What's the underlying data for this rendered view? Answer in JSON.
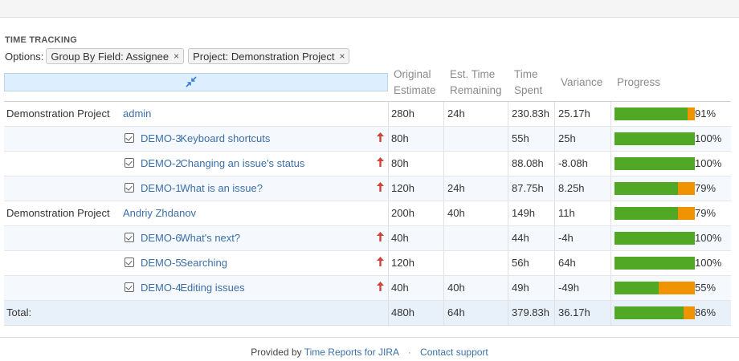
{
  "section_title": "TIME TRACKING",
  "options_label": "Options:",
  "filters": [
    {
      "label": "Group By Field: Assignee",
      "remove": "×"
    },
    {
      "label": "Project: Demonstration Project",
      "remove": "×"
    }
  ],
  "columns": {
    "original_estimate": [
      "Original",
      "Estimate"
    ],
    "est_time_remaining": [
      "Est. Time",
      "Remaining"
    ],
    "time_spent": [
      "Time",
      "Spent"
    ],
    "variance": "Variance",
    "progress": "Progress"
  },
  "colors": {
    "progress_done": "#51a825",
    "progress_remaining": "#f09300",
    "link": "#3b6ea8",
    "priority": "#d04437"
  },
  "rows": [
    {
      "type": "group",
      "project": "Demonstration Project",
      "assignee": "admin",
      "original": "280h",
      "remaining": "24h",
      "spent": "230.83h",
      "variance": "25.17h",
      "progress": 0.91,
      "progress_label": "91%"
    },
    {
      "type": "issue",
      "key": "DEMO-3",
      "summary": "Keyboard shortcuts",
      "issue_icon": "issue-task-icon",
      "priority_icon": "priority-major-arrow-up-icon",
      "original": "80h",
      "remaining": "",
      "spent": "55h",
      "variance": "25h",
      "progress": 1.0,
      "progress_label": "100%"
    },
    {
      "type": "issue",
      "key": "DEMO-2",
      "summary": "Changing an issue's status",
      "issue_icon": "issue-task-icon",
      "priority_icon": "priority-major-arrow-up-icon",
      "original": "80h",
      "remaining": "",
      "spent": "88.08h",
      "variance": "-8.08h",
      "progress": 1.0,
      "progress_label": "100%"
    },
    {
      "type": "issue",
      "key": "DEMO-1",
      "summary": "What is an issue?",
      "issue_icon": "issue-task-icon",
      "priority_icon": "priority-major-arrow-up-icon",
      "original": "120h",
      "remaining": "24h",
      "spent": "87.75h",
      "variance": "8.25h",
      "progress": 0.79,
      "progress_label": "79%"
    },
    {
      "type": "group",
      "project": "Demonstration Project",
      "assignee": "Andriy Zhdanov",
      "original": "200h",
      "remaining": "40h",
      "spent": "149h",
      "variance": "11h",
      "progress": 0.79,
      "progress_label": "79%"
    },
    {
      "type": "issue",
      "key": "DEMO-6",
      "summary": "What's next?",
      "issue_icon": "issue-task-icon",
      "priority_icon": "priority-major-arrow-up-icon",
      "original": "40h",
      "remaining": "",
      "spent": "44h",
      "variance": "-4h",
      "progress": 1.0,
      "progress_label": "100%"
    },
    {
      "type": "issue",
      "key": "DEMO-5",
      "summary": "Searching",
      "issue_icon": "issue-task-icon",
      "priority_icon": "priority-major-arrow-up-icon",
      "original": "120h",
      "remaining": "",
      "spent": "56h",
      "variance": "64h",
      "progress": 1.0,
      "progress_label": "100%"
    },
    {
      "type": "issue",
      "key": "DEMO-4",
      "summary": "Editing issues",
      "issue_icon": "issue-task-icon",
      "priority_icon": "priority-major-arrow-up-icon",
      "original": "40h",
      "remaining": "40h",
      "spent": "49h",
      "variance": "-49h",
      "progress": 0.55,
      "progress_label": "55%"
    }
  ],
  "total": {
    "label": "Total:",
    "original": "480h",
    "remaining": "64h",
    "spent": "379.83h",
    "variance": "36.17h",
    "progress": 0.86,
    "progress_label": "86%"
  },
  "footer": {
    "provided_by": "Provided by",
    "product_link": "Time Reports for JIRA",
    "separator": "·",
    "support_link": "Contact support"
  }
}
